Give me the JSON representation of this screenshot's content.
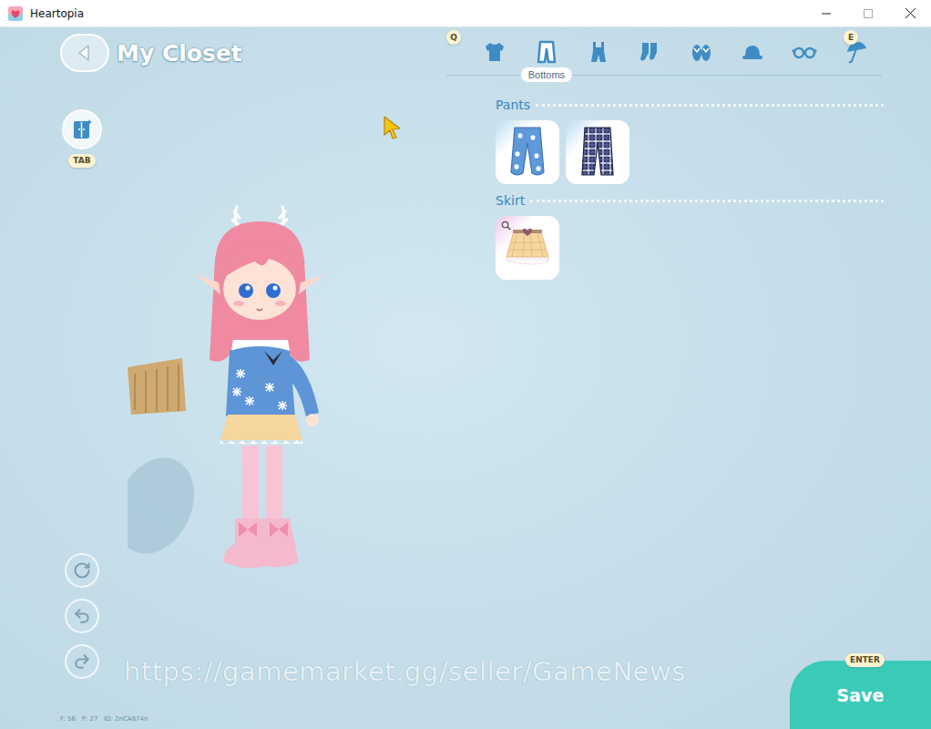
{
  "window": {
    "title": "Heartopia"
  },
  "header": {
    "title": "My Closet"
  },
  "wardrobe_button": {
    "key": "TAB"
  },
  "category_bar": {
    "prev_key": "Q",
    "next_key": "E",
    "categories": [
      {
        "selected": false
      },
      {
        "selected": true,
        "label": "Bottoms"
      },
      {
        "selected": false
      },
      {
        "selected": false
      },
      {
        "selected": false
      },
      {
        "selected": false
      },
      {
        "selected": false
      },
      {
        "selected": false
      }
    ]
  },
  "sections": [
    {
      "title": "Pants",
      "items": [
        {
          "selected": false
        },
        {
          "selected": false
        }
      ]
    },
    {
      "title": "Skirt",
      "items": [
        {
          "selected": true
        }
      ]
    }
  ],
  "save_button": {
    "label": "Save",
    "key": "ENTER"
  },
  "watermark": "https://gamemarket.gg/seller/GameNews",
  "debug_info": "F: 56   P: 27   ID: 2nCA674n"
}
